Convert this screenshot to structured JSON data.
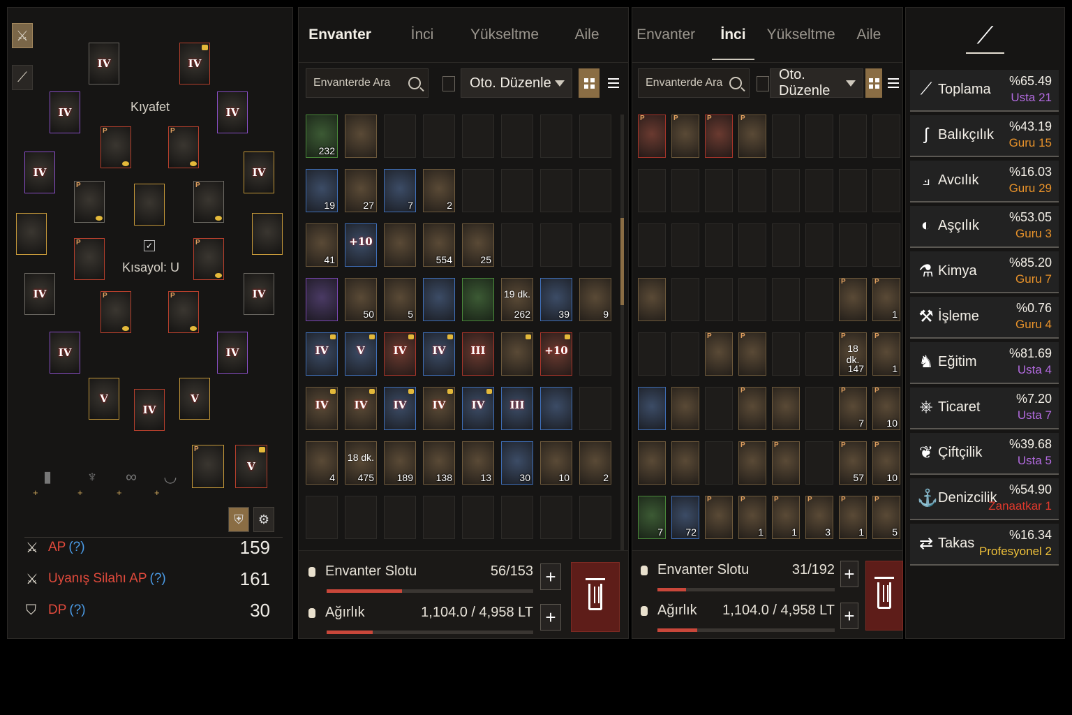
{
  "equipment": {
    "costume_label": "Kıyafet",
    "shortcut_label": "Kısayol: U",
    "checkbox": "✓",
    "stats": [
      {
        "label": "AP",
        "help": "(?)",
        "value": "159"
      },
      {
        "label": "Uyanış Silahı AP",
        "help": "(?)",
        "value": "161"
      },
      {
        "label": "DP",
        "help": "(?)",
        "value": "30"
      }
    ],
    "grades": {
      "IV": "IV",
      "V": "V"
    }
  },
  "inventory_left": {
    "tabs": [
      "Envanter",
      "İnci",
      "Yükseltme",
      "Aile"
    ],
    "search_placeholder": "Envanterde Ara",
    "sort_label": "Oto. Düzenle",
    "slot_label": "Envanter Slotu",
    "slot_value": "56/153",
    "slot_fill": 0.366,
    "weight_label": "Ağırlık",
    "weight_value": "1,104.0 / 4,958 LT",
    "weight_fill": 0.223,
    "rows": [
      [
        {
          "c": "232",
          "t": "green"
        },
        {
          "t": "f"
        },
        {},
        {},
        {},
        {},
        {},
        {}
      ],
      [
        {
          "c": "19",
          "t": "blue"
        },
        {
          "c": "27",
          "t": "f"
        },
        {
          "c": "7",
          "t": "blue"
        },
        {
          "c": "2",
          "t": "f"
        },
        {},
        {},
        {},
        {}
      ],
      [
        {
          "c": "41",
          "t": "f"
        },
        {
          "g": "+10",
          "t": "blue"
        },
        {
          "t": "f"
        },
        {
          "c": "554",
          "t": "f"
        },
        {
          "c": "25",
          "t": "f"
        },
        {},
        {},
        {}
      ],
      [
        {
          "t": "purple"
        },
        {
          "c": "50",
          "t": "f"
        },
        {
          "c": "5",
          "t": "f"
        },
        {
          "t": "blue"
        },
        {
          "t": "green"
        },
        {
          "top": "19 dk.",
          "c": "262",
          "t": "f"
        },
        {
          "c": "39",
          "t": "blue"
        },
        {
          "c": "9",
          "t": "f"
        }
      ],
      [
        {
          "g": "IV",
          "t": "blue",
          "l": true
        },
        {
          "g": "V",
          "t": "blue",
          "l": true
        },
        {
          "g": "IV",
          "t": "red",
          "l": true
        },
        {
          "g": "IV",
          "t": "blue",
          "l": true
        },
        {
          "g": "III",
          "t": "red"
        },
        {
          "t": "f",
          "l": true
        },
        {
          "g": "+10",
          "t": "red",
          "l": true
        },
        {}
      ],
      [
        {
          "g": "IV",
          "t": "f",
          "l": true
        },
        {
          "g": "IV",
          "t": "f",
          "l": true
        },
        {
          "g": "IV",
          "t": "blue",
          "l": true
        },
        {
          "g": "IV",
          "t": "f",
          "l": true
        },
        {
          "g": "IV",
          "t": "blue",
          "l": true
        },
        {
          "g": "III",
          "t": "blue"
        },
        {
          "t": "blue"
        },
        {}
      ],
      [
        {
          "c": "4",
          "t": "f"
        },
        {
          "top": "18 dk.",
          "c": "475",
          "t": "f"
        },
        {
          "c": "189",
          "t": "f"
        },
        {
          "c": "138",
          "t": "f"
        },
        {
          "c": "13",
          "t": "f"
        },
        {
          "c": "30",
          "t": "blue"
        },
        {
          "c": "10",
          "t": "f"
        },
        {
          "c": "2",
          "t": "f"
        }
      ],
      [
        {},
        {},
        {},
        {},
        {},
        {},
        {},
        {}
      ]
    ]
  },
  "inventory_right": {
    "tabs": [
      "Envanter",
      "İnci",
      "Yükseltme",
      "Aile"
    ],
    "search_placeholder": "Envanterde Ara",
    "sort_label": "Oto. Düzenle",
    "slot_label": "Envanter Slotu",
    "slot_value": "31/192",
    "slot_fill": 0.161,
    "weight_label": "Ağırlık",
    "weight_value": "1,104.0 / 4,958 LT",
    "weight_fill": 0.223,
    "rows": [
      [
        {
          "p": true,
          "t": "red"
        },
        {
          "p": true,
          "t": "f"
        },
        {
          "p": true,
          "t": "red"
        },
        {
          "p": true,
          "t": "f"
        },
        {},
        {},
        {},
        {}
      ],
      [
        {},
        {},
        {},
        {},
        {},
        {},
        {},
        {}
      ],
      [
        {},
        {},
        {},
        {},
        {},
        {},
        {},
        {}
      ],
      [
        {
          "t": "f"
        },
        {},
        {},
        {},
        {},
        {},
        {
          "p": true,
          "t": "f"
        },
        {
          "p": true,
          "c": "1",
          "t": "f"
        }
      ],
      [
        {},
        {},
        {
          "p": true,
          "t": "f"
        },
        {
          "p": true,
          "t": "f"
        },
        {},
        {},
        {
          "p": true,
          "top": "18 dk.",
          "c": "147",
          "t": "f"
        },
        {
          "p": true,
          "c": "1",
          "t": "f"
        }
      ],
      [
        {
          "t": "blue"
        },
        {
          "t": "f"
        },
        {},
        {
          "p": true,
          "t": "f"
        },
        {
          "t": "f"
        },
        {},
        {
          "p": true,
          "c": "7",
          "t": "f"
        },
        {
          "p": true,
          "c": "10",
          "t": "f"
        }
      ],
      [
        {
          "t": "f"
        },
        {
          "t": "f"
        },
        {},
        {
          "p": true,
          "t": "f"
        },
        {
          "p": true,
          "t": "f"
        },
        {},
        {
          "p": true,
          "c": "57",
          "t": "f"
        },
        {
          "p": true,
          "c": "10",
          "t": "f"
        }
      ],
      [
        {
          "c": "7",
          "t": "green"
        },
        {
          "c": "72",
          "t": "blue"
        },
        {
          "p": true,
          "t": "f"
        },
        {
          "p": true,
          "c": "1",
          "t": "f"
        },
        {
          "p": true,
          "c": "1",
          "t": "f"
        },
        {
          "p": true,
          "c": "3",
          "t": "f"
        },
        {
          "p": true,
          "c": "1",
          "t": "f"
        },
        {
          "p": true,
          "c": "5",
          "t": "f"
        }
      ]
    ]
  },
  "life_skills": [
    {
      "name": "Toplama",
      "pct": "%65.49",
      "rank": "Usta 21",
      "color": "#b36be0",
      "icon": "sickle-icon",
      "glyph": "⟋"
    },
    {
      "name": "Balıkçılık",
      "pct": "%43.19",
      "rank": "Guru 15",
      "color": "#e8922a",
      "icon": "fish-icon",
      "glyph": "ʃ"
    },
    {
      "name": "Avcılık",
      "pct": "%16.03",
      "rank": "Guru 29",
      "color": "#e8922a",
      "icon": "musket-icon",
      "glyph": "⟓"
    },
    {
      "name": "Aşçılık",
      "pct": "%53.05",
      "rank": "Guru 3",
      "color": "#e8922a",
      "icon": "cooking-icon",
      "glyph": "◐"
    },
    {
      "name": "Kimya",
      "pct": "%85.20",
      "rank": "Guru 7",
      "color": "#e8922a",
      "icon": "flask-icon",
      "glyph": "⚗"
    },
    {
      "name": "İşleme",
      "pct": "%0.76",
      "rank": "Guru 4",
      "color": "#e8922a",
      "icon": "hammer-icon",
      "glyph": "⚒"
    },
    {
      "name": "Eğitim",
      "pct": "%81.69",
      "rank": "Usta 4",
      "color": "#b36be0",
      "icon": "horse-icon",
      "glyph": "♞"
    },
    {
      "name": "Ticaret",
      "pct": "%7.20",
      "rank": "Usta 7",
      "color": "#b36be0",
      "icon": "wheel-icon",
      "glyph": "⎈"
    },
    {
      "name": "Çiftçilik",
      "pct": "%39.68",
      "rank": "Usta 5",
      "color": "#b36be0",
      "icon": "sprout-icon",
      "glyph": "❦"
    },
    {
      "name": "Denizcilik",
      "pct": "%54.90",
      "rank": "Zanaatkar 1",
      "color": "#e0392c",
      "icon": "anchor-icon",
      "glyph": "⚓"
    },
    {
      "name": "Takas",
      "pct": "%16.34",
      "rank": "Profesyonel 2",
      "color": "#f0c23a",
      "icon": "exchange-icon",
      "glyph": "⇄"
    }
  ]
}
